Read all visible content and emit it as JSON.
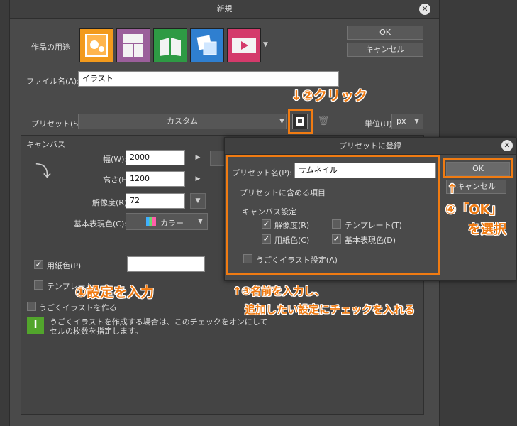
{
  "main_dialog": {
    "title": "新規",
    "ok": "OK",
    "cancel": "キャンセル",
    "purpose_label": "作品の用途",
    "purpose_icons": [
      "illustration-icon",
      "comic-icon",
      "book-icon",
      "story-icon",
      "animation-icon"
    ],
    "filename_label": "ファイル名(A):",
    "filename_value": "イラスト",
    "preset_label": "プリセット(S):",
    "preset_value": "カスタム",
    "unit_label": "単位(U):",
    "unit_value": "px",
    "canvas_section": "キャンバス",
    "width_label": "幅(W):",
    "width_value": "2000",
    "height_label": "高さ(H):",
    "height_value": "1200",
    "resolution_label": "解像度(R):",
    "resolution_value": "72",
    "color_label": "基本表現色(C):",
    "color_value": "カラー",
    "paper_color_label": "用紙色(P)",
    "template_label": "テンプレート",
    "animation_check_label": "うごくイラストを作る",
    "info_text_1": "うごくイラストを作成する場合は、このチェックをオンにして",
    "info_text_2": "セルの枚数を指定します。"
  },
  "sub_dialog": {
    "title": "プリセットに登録",
    "name_label": "プリセット名(P):",
    "name_value": "サムネイル",
    "include_label": "プリセットに含める項目",
    "canvas_settings": "キャンバス設定",
    "resolution": "解像度(R)",
    "template": "テンプレート(T)",
    "paper_color": "用紙色(C)",
    "base_color": "基本表現色(D)",
    "animation": "うごくイラスト設定(A)",
    "ok": "OK",
    "cancel": "キャンセル"
  },
  "annotations": {
    "step1": "①設定を入力",
    "step2": "↓②クリック",
    "step3_line1": "↑③名前を入力し、",
    "step3_line2": "追加したい設定にチェックを入れる",
    "step4_arrow": "↑",
    "step4_line1": "④「OK」",
    "step4_line2": "を選択"
  },
  "colors": {
    "accent": "#f07b12",
    "dialog_bg": "#4a4a4a",
    "selected_purpose": "#f29a1c"
  }
}
